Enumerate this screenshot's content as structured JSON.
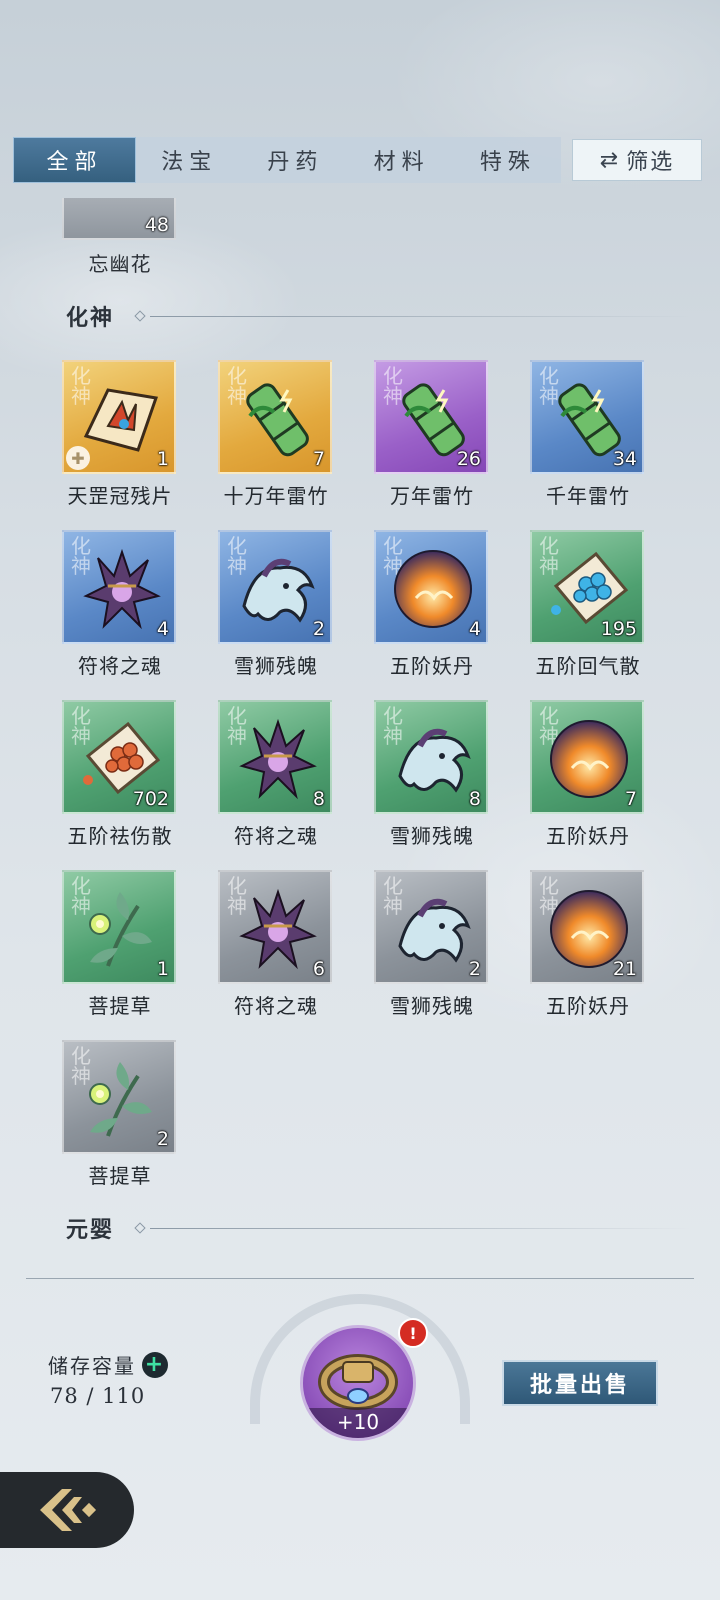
{
  "tabs": [
    {
      "label": "全部",
      "active": true
    },
    {
      "label": "法宝",
      "active": false
    },
    {
      "label": "丹药",
      "active": false
    },
    {
      "label": "材料",
      "active": false
    },
    {
      "label": "特殊",
      "active": false
    }
  ],
  "filter": {
    "label": "筛选",
    "icon": "swap-arrows-icon"
  },
  "previous_item": {
    "name": "忘幽花",
    "count": "48"
  },
  "sections": {
    "huashen": {
      "title": "化神"
    },
    "yuanying": {
      "title": "元婴"
    }
  },
  "seal_char": "化神",
  "items": [
    {
      "name": "天罡冠残片",
      "count": "1",
      "rarity": "gold",
      "icon": "crown-fragment-icon"
    },
    {
      "name": "十万年雷竹",
      "count": "7",
      "rarity": "gold",
      "icon": "thunder-bamboo-icon"
    },
    {
      "name": "万年雷竹",
      "count": "26",
      "rarity": "purple",
      "icon": "thunder-bamboo-icon"
    },
    {
      "name": "千年雷竹",
      "count": "34",
      "rarity": "blue",
      "icon": "thunder-bamboo-icon"
    },
    {
      "name": "符将之魂",
      "count": "4",
      "rarity": "blue",
      "icon": "talisman-soul-icon"
    },
    {
      "name": "雪狮残魄",
      "count": "2",
      "rarity": "blue",
      "icon": "snow-lion-spirit-icon"
    },
    {
      "name": "五阶妖丹",
      "count": "4",
      "rarity": "blue",
      "icon": "demon-core-icon"
    },
    {
      "name": "五阶回气散",
      "count": "195",
      "rarity": "green",
      "icon": "blue-powder-icon"
    },
    {
      "name": "五阶祛伤散",
      "count": "702",
      "rarity": "green",
      "icon": "red-powder-icon"
    },
    {
      "name": "符将之魂",
      "count": "8",
      "rarity": "green",
      "icon": "talisman-soul-icon"
    },
    {
      "name": "雪狮残魄",
      "count": "8",
      "rarity": "green",
      "icon": "snow-lion-spirit-icon"
    },
    {
      "name": "五阶妖丹",
      "count": "7",
      "rarity": "green",
      "icon": "demon-core-icon"
    },
    {
      "name": "菩提草",
      "count": "1",
      "rarity": "green",
      "icon": "bodhi-herb-icon"
    },
    {
      "name": "符将之魂",
      "count": "6",
      "rarity": "gray",
      "icon": "talisman-soul-icon"
    },
    {
      "name": "雪狮残魄",
      "count": "2",
      "rarity": "gray",
      "icon": "snow-lion-spirit-icon"
    },
    {
      "name": "五阶妖丹",
      "count": "21",
      "rarity": "gray",
      "icon": "demon-core-icon"
    },
    {
      "name": "菩提草",
      "count": "2",
      "rarity": "gray",
      "icon": "bodhi-herb-icon"
    }
  ],
  "footer": {
    "storage_label": "储存容量",
    "storage_value": "78 / 110",
    "ring_level": "+10",
    "alert_mark": "!",
    "sell_label": "批量出售"
  },
  "colors": {
    "gold": "#e3a93e",
    "purple": "#9a60c8",
    "blue": "#5a88c7",
    "green": "#4fa171",
    "gray": "#8c939b",
    "tab_active": "#35607f",
    "sell_button": "#2f5877"
  }
}
